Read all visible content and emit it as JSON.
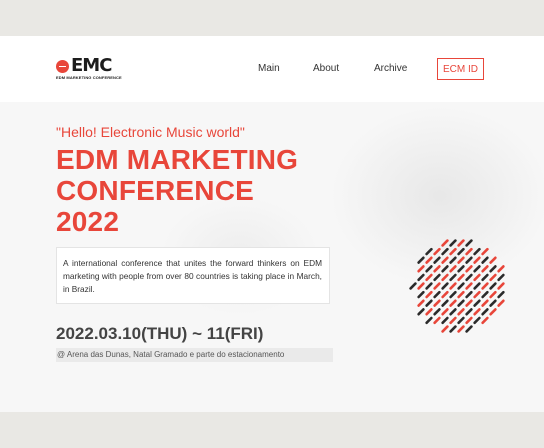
{
  "header": {
    "logo": {
      "text": "EMC",
      "subtext": "EDM MARKETING CONFERENCE"
    },
    "nav": [
      {
        "label": "Main"
      },
      {
        "label": "About"
      },
      {
        "label": "Archive"
      }
    ],
    "cta_label": "ECM ID"
  },
  "hero": {
    "greeting": "\"Hello! Electronic Music world\"",
    "title_lines": [
      "EDM MARKETING",
      "CONFERENCE",
      "2022"
    ],
    "description": "A international conference that unites the forward thinkers on EDM marketing with people from over 80 countries is taking place in March, in Brazil.",
    "date": "2022.03.10(THU) ~ 11(FRI)",
    "venue": "@ Arena das Dunas, Natal Gramado e parte do estacionamento"
  },
  "colors": {
    "accent": "#e8463a",
    "dark": "#2b2b2b",
    "header_bg": "#ffffff",
    "page_bg": "#f7f7f7",
    "frame_bg": "#e9e8e4"
  },
  "icons": {
    "logo_mark": "record-disc-icon",
    "decoration": "dot-pattern-circle"
  }
}
